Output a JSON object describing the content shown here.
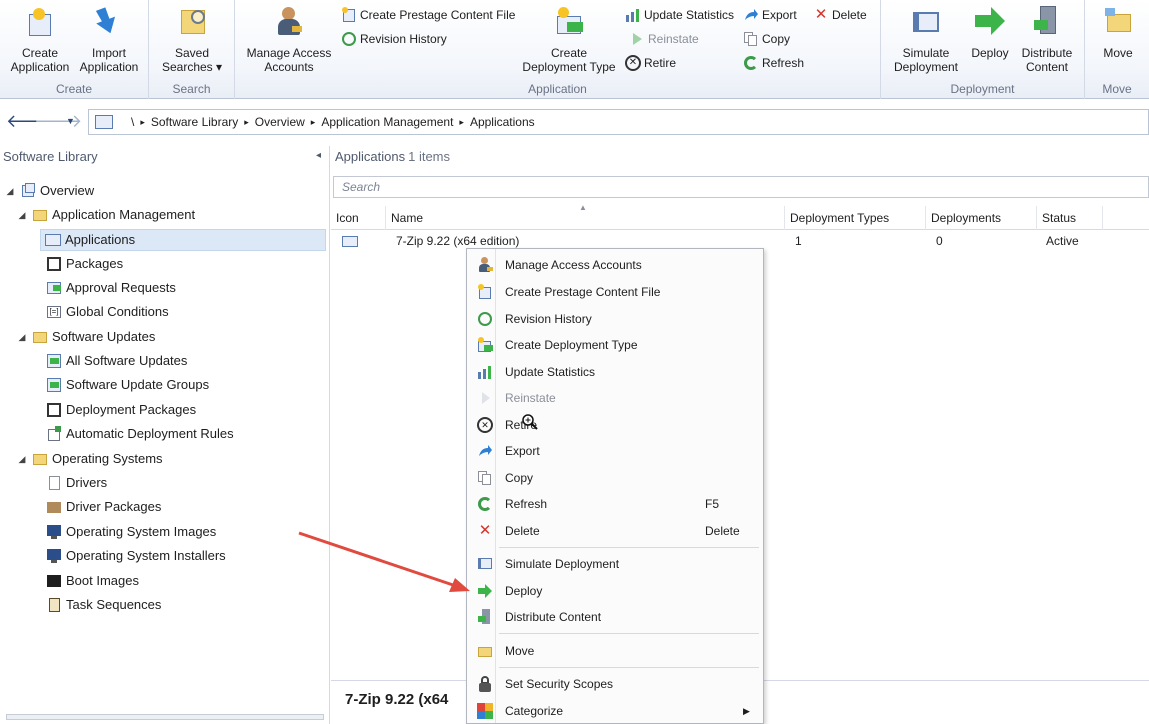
{
  "ribbon": {
    "groups": {
      "create": "Create",
      "search": "Search",
      "application": "Application",
      "deployment": "Deployment",
      "move": "Move"
    },
    "buttons": {
      "create_application": "Create\nApplication",
      "import_application": "Import\nApplication",
      "saved_searches": "Saved\nSearches ▾",
      "manage_access_accounts": "Manage Access\nAccounts",
      "create_prestage": "Create Prestage Content File",
      "revision_history": "Revision History",
      "create_deployment_type": "Create\nDeployment Type",
      "update_statistics": "Update Statistics",
      "reinstate": "Reinstate",
      "retire": "Retire",
      "export": "Export",
      "copy": "Copy",
      "refresh": "Refresh",
      "delete": "Delete",
      "simulate_deployment": "Simulate\nDeployment",
      "deploy": "Deploy",
      "distribute_content": "Distribute\nContent",
      "move": "Move"
    }
  },
  "address": {
    "root": "\\",
    "crumbs": [
      "Software Library",
      "Overview",
      "Application Management",
      "Applications"
    ]
  },
  "nav": {
    "header": "Software Library",
    "items": [
      {
        "label": "Overview",
        "icon": "overview-icon"
      },
      {
        "label": "Application Management",
        "icon": "folder-icon"
      },
      {
        "label": "Applications",
        "icon": "application-icon"
      },
      {
        "label": "Packages",
        "icon": "package-icon"
      },
      {
        "label": "Approval Requests",
        "icon": "approval-icon"
      },
      {
        "label": "Global Conditions",
        "icon": "condition-icon"
      },
      {
        "label": "Software Updates",
        "icon": "folder-icon"
      },
      {
        "label": "All Software Updates",
        "icon": "updates-icon"
      },
      {
        "label": "Software Update Groups",
        "icon": "update-groups-icon"
      },
      {
        "label": "Deployment Packages",
        "icon": "package-icon"
      },
      {
        "label": "Automatic Deployment Rules",
        "icon": "rules-icon"
      },
      {
        "label": "Operating Systems",
        "icon": "folder-icon"
      },
      {
        "label": "Drivers",
        "icon": "driver-icon"
      },
      {
        "label": "Driver Packages",
        "icon": "driver-package-icon"
      },
      {
        "label": "Operating System Images",
        "icon": "os-image-icon"
      },
      {
        "label": "Operating System Installers",
        "icon": "os-installer-icon"
      },
      {
        "label": "Boot Images",
        "icon": "boot-image-icon"
      },
      {
        "label": "Task Sequences",
        "icon": "task-sequence-icon"
      }
    ]
  },
  "list": {
    "title": "Applications",
    "count": "1 items",
    "search_placeholder": "Search",
    "columns": [
      "Icon",
      "Name",
      "Deployment Types",
      "Deployments",
      "Status"
    ],
    "rows": [
      {
        "name": "7-Zip 9.22 (x64 edition)",
        "deployment_types": "1",
        "deployments": "0",
        "status": "Active"
      }
    ],
    "detail_title": "7-Zip 9.22 (x64"
  },
  "context_menu": {
    "items": [
      {
        "label": "Manage Access Accounts",
        "shortcut": "",
        "enabled": true
      },
      {
        "label": "Create Prestage Content File",
        "shortcut": "",
        "enabled": true
      },
      {
        "label": "Revision History",
        "shortcut": "",
        "enabled": true
      },
      {
        "label": "Create Deployment Type",
        "shortcut": "",
        "enabled": true
      },
      {
        "label": "Update Statistics",
        "shortcut": "",
        "enabled": true
      },
      {
        "label": "Reinstate",
        "shortcut": "",
        "enabled": false
      },
      {
        "label": "Retire",
        "shortcut": "",
        "enabled": true
      },
      {
        "label": "Export",
        "shortcut": "",
        "enabled": true
      },
      {
        "label": "Copy",
        "shortcut": "",
        "enabled": true
      },
      {
        "label": "Refresh",
        "shortcut": "F5",
        "enabled": true
      },
      {
        "label": "Delete",
        "shortcut": "Delete",
        "enabled": true
      },
      {
        "label": "Simulate Deployment",
        "shortcut": "",
        "enabled": true
      },
      {
        "label": "Deploy",
        "shortcut": "",
        "enabled": true
      },
      {
        "label": "Distribute Content",
        "shortcut": "",
        "enabled": true
      },
      {
        "label": "Move",
        "shortcut": "",
        "enabled": true
      },
      {
        "label": "Set Security Scopes",
        "shortcut": "",
        "enabled": true
      },
      {
        "label": "Categorize",
        "shortcut": "",
        "enabled": true
      }
    ]
  },
  "colors": {
    "deploy_green": "#3cb44a",
    "delete_red": "#d9342b",
    "annotation_arrow": "#e04a3f",
    "selection": "#dce8f6"
  }
}
